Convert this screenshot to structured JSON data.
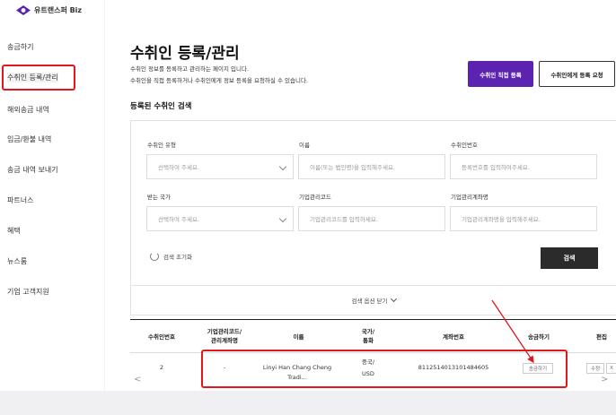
{
  "brand": {
    "name": "유트랜스퍼 Biz",
    "logo_color": "#5b23b0"
  },
  "sidebar": {
    "items": [
      {
        "label": "송금하기"
      },
      {
        "label": "수취인 등록/관리",
        "active": true
      },
      {
        "label": "해외송금 내역"
      },
      {
        "label": "입금/환불 내역"
      },
      {
        "label": "송금 내역 보내기"
      },
      {
        "label": "파트너스"
      },
      {
        "label": "혜택"
      },
      {
        "label": "뉴스룸"
      },
      {
        "label": "기업 고객지원"
      }
    ]
  },
  "page": {
    "title": "수취인 등록/관리",
    "desc1": "수취인 정보를 등록하고 관리하는 페이지 입니다.",
    "desc2": "수취인을 직접 등록하거나 수취인에게 정보 등록을 요청하실 수 있습니다.",
    "btn_direct": "수취인 직접 등록",
    "btn_request": "수취인에게 등록 요청",
    "section_title": "등록된 수취인 검색"
  },
  "filters": {
    "type_label": "수취인 유형",
    "type_placeholder": "선택하여 주세요.",
    "name_label": "이름",
    "name_placeholder": "이름(또는 법인명)을 입력해주세요.",
    "number_label": "수취인번호",
    "number_placeholder": "등록번호를 입력하여주세요.",
    "country_label": "받는 국가",
    "country_placeholder": "선택하여 주세요.",
    "code_label": "기업관리코드",
    "code_placeholder": "기업관리코드를 입력하세요.",
    "account_label": "기업관리계좌명",
    "account_placeholder": "기업관리계좌명을 입력해주세요.",
    "reset_label": "검색 초기화",
    "search_label": "검색",
    "collapse_label": "검색 옵션 닫기"
  },
  "table": {
    "headers": {
      "number": "수취인번호",
      "code1": "기업관리코드/",
      "code2": "관리계좌명",
      "name": "이름",
      "country1": "국가/",
      "country2": "통화",
      "account": "계좌번호",
      "send": "송금하기",
      "edit": "편집"
    },
    "row": {
      "number": "2",
      "code": "-",
      "name": "Linyi Han Chang Cheng Tradi...",
      "country": "중국/",
      "currency": "USD",
      "account": "811251401310148460​5",
      "send_btn": "송금하기",
      "edit_btn": "수정",
      "extra_btn": "X"
    }
  },
  "colors": {
    "accent": "#5b23b0",
    "annotation": "#e2161b"
  }
}
